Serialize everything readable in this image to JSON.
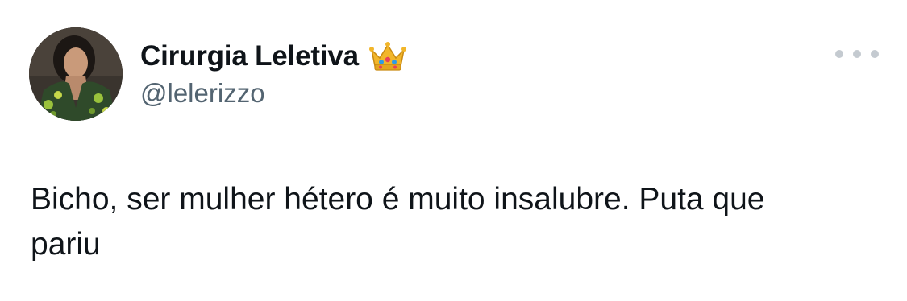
{
  "tweet": {
    "display_name": "Cirurgia Leletiva",
    "badge_icon": "crown-emoji",
    "handle": "@lelerizzo",
    "text": "Bicho, ser mulher hétero é muito insalubre. Puta que\npariu",
    "more_icon": "more-horizontal-icon",
    "colors": {
      "text": "#0f1419",
      "secondary": "#536471",
      "more_dots": "#c4cad0",
      "background": "#ffffff"
    }
  }
}
